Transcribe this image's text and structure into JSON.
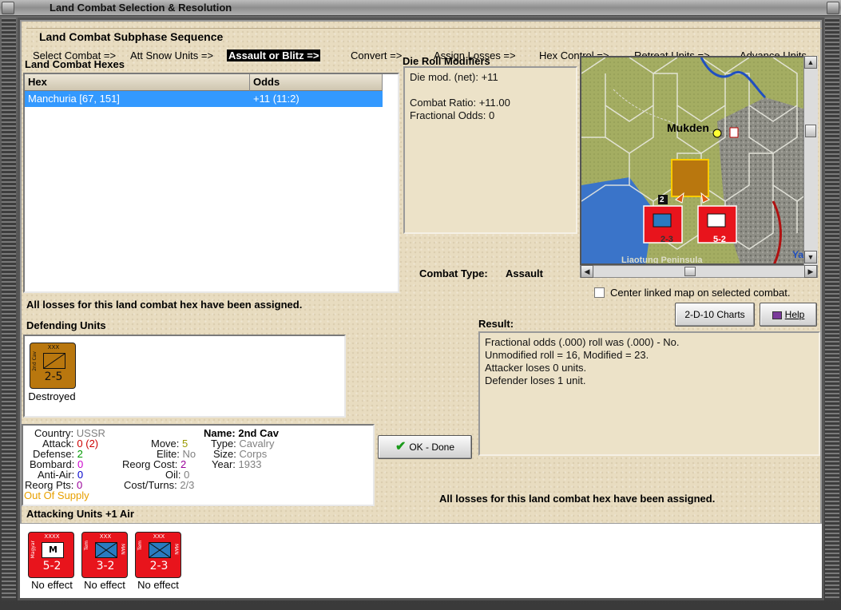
{
  "window": {
    "title": "Land Combat Selection & Resolution"
  },
  "subphase": {
    "title": "Land Combat Subphase Sequence",
    "steps": [
      "Select Combat =>",
      "Att Snow Units =>",
      "Assault or Blitz =>",
      "Convert =>",
      "Assign Losses =>",
      "Hex Control =>",
      "Retreat Units =>",
      "Advance Units"
    ],
    "active_index": 2
  },
  "hexes": {
    "label": "Land Combat Hexes",
    "columns": [
      "Hex",
      "Odds"
    ],
    "rows": [
      {
        "hex": "Manchuria [67, 151]",
        "odds": "+11 (11:2)"
      }
    ]
  },
  "die_roll": {
    "label": "Die Roll Modifiers",
    "lines": [
      "Die mod. (net): +11",
      "",
      "Combat Ratio: +11.00",
      "Fractional Odds: 0"
    ]
  },
  "map": {
    "city": "Mukden",
    "region": "Liaotung Peninsula",
    "edge_text": "Ya",
    "stack_count": "2",
    "colors": {
      "land": "#a4ad62",
      "mountain": "#8e8e86",
      "water": "#3a74c9",
      "river": "#2050c0",
      "border": "#b01010"
    }
  },
  "combat_type": {
    "label": "Combat Type:",
    "value": "Assault"
  },
  "center_map": {
    "label": "Center linked map on selected combat.",
    "checked": false
  },
  "buttons": {
    "charts": "2-D-10 Charts",
    "help": "Help",
    "ok": "OK - Done"
  },
  "status_message": "All losses for this land combat hex have been assigned.",
  "status_message_2": "All losses for this land combat hex have been assigned.",
  "defending": {
    "label": "Defending Units",
    "units": [
      {
        "size": "XXX",
        "side_label": "2nd Cav",
        "strength": "2-5",
        "caption": "Destroyed",
        "color": "brown"
      }
    ]
  },
  "result": {
    "label": "Result:",
    "lines": [
      "Fractional odds (.000) roll was (.000)  - No.",
      "Unmodified roll = 16, Modified = 23.",
      "Attacker loses 0 units.",
      "Defender loses 1 unit."
    ]
  },
  "unit_info": {
    "country_label": "Country:",
    "country": "USSR",
    "attack_label": "Attack:",
    "attack": "0",
    "attack_paren": "(2)",
    "defense_label": "Defense:",
    "defense": "2",
    "bombard_label": "Bombard:",
    "bombard": "0",
    "antiair_label": "Anti-Air:",
    "antiair": "0",
    "reorg_pts_label": "Reorg Pts:",
    "reorg_pts": "0",
    "supply": "Out Of Supply",
    "move_label": "Move:",
    "move": "5",
    "elite_label": "Elite:",
    "elite": "No",
    "reorg_cost_label": "Reorg Cost:",
    "reorg_cost": "2",
    "oil_label": "Oil:",
    "oil": "0",
    "cost_turns_label": "Cost/Turns:",
    "cost_turns": "2/3",
    "name_label": "Name:",
    "name": "2nd Cav",
    "type_label": "Type:",
    "type": "Cavalry",
    "size_label": "Size:",
    "size": "Corps",
    "year_label": "Year:",
    "year": "1933"
  },
  "attacking": {
    "label": "Attacking Units +1 Air",
    "units": [
      {
        "size": "XXXX",
        "side_label": "Magyar",
        "inner": "M",
        "strength": "5-2",
        "caption": "No effect",
        "color": "red"
      },
      {
        "size": "XXX",
        "side_label": "Tem",
        "right_label": "MAN",
        "strength": "3-2",
        "caption": "No effect",
        "color": "red"
      },
      {
        "size": "XXX",
        "side_label": "Tem",
        "right_label": "MAN",
        "strength": "2-3",
        "caption": "No effect",
        "color": "red"
      }
    ]
  }
}
